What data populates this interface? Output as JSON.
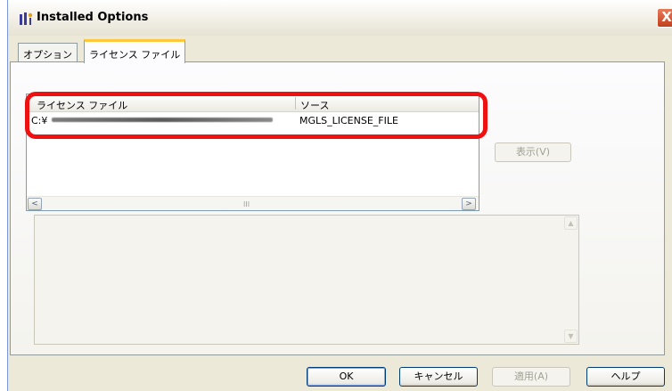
{
  "window": {
    "title": "Installed Options",
    "close_label": "X"
  },
  "tabs": [
    {
      "label": "オプション",
      "active": false
    },
    {
      "label": "ライセンス ファイル",
      "active": true
    }
  ],
  "license_list": {
    "columns": [
      "ライセンス ファイル",
      "ソース"
    ],
    "rows": [
      {
        "file": "C:¥",
        "source": "MGLS_LICENSE_FILE"
      }
    ],
    "scroll_grip": "III"
  },
  "buttons": {
    "view": "表示(V)",
    "ok": "OK",
    "cancel": "キャンセル",
    "apply": "適用(A)",
    "help": "ヘルプ"
  },
  "colors": {
    "highlight": "#ee1111",
    "tab_accent": "#ffc83c"
  }
}
